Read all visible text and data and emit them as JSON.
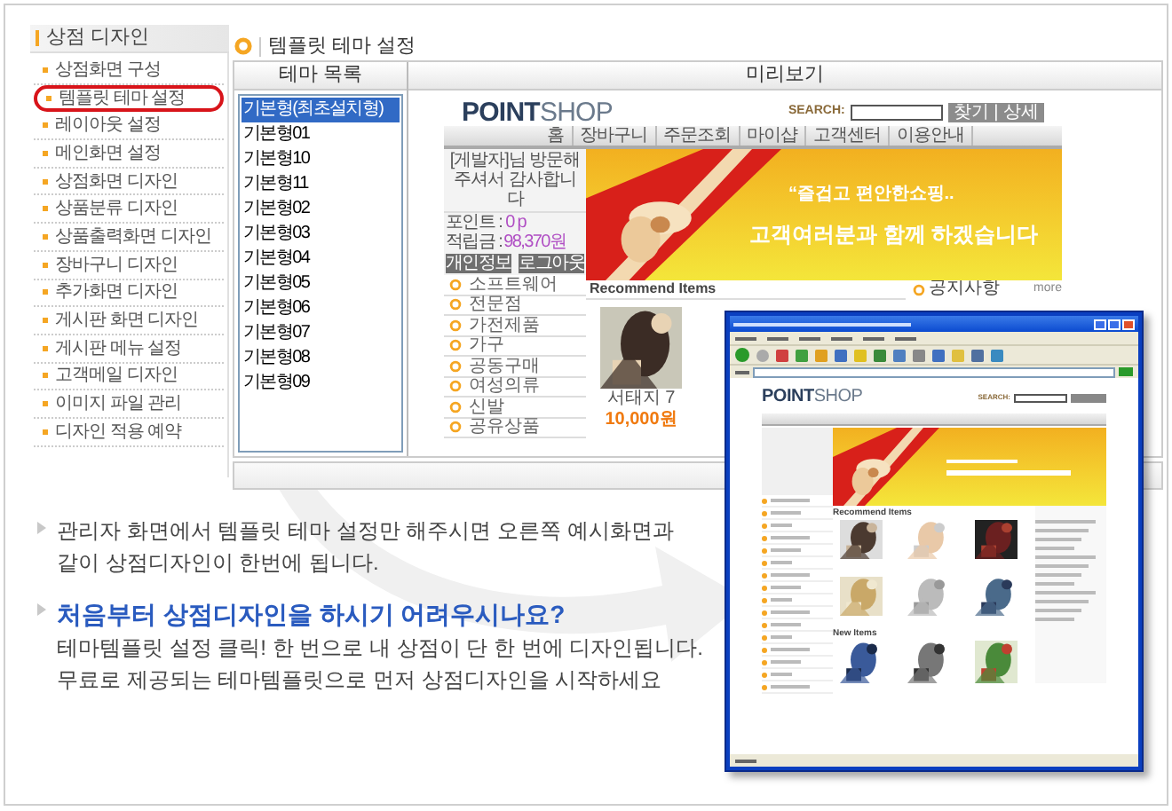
{
  "sidebar": {
    "title": "상점 디자인",
    "items": [
      {
        "label": "상점화면 구성",
        "selected": false
      },
      {
        "label": "템플릿 테마 설정",
        "selected": true
      },
      {
        "label": "레이아웃 설정",
        "selected": false
      },
      {
        "label": "메인화면 설정",
        "selected": false
      },
      {
        "label": "상점화면 디자인",
        "selected": false
      },
      {
        "label": "상품분류 디자인",
        "selected": false
      },
      {
        "label": "상품출력화면 디자인",
        "selected": false
      },
      {
        "label": "장바구니 디자인",
        "selected": false
      },
      {
        "label": "추가화면 디자인",
        "selected": false
      },
      {
        "label": "게시판 화면 디자인",
        "selected": false
      },
      {
        "label": "게시판 메뉴 설정",
        "selected": false
      },
      {
        "label": "고객메일 디자인",
        "selected": false
      },
      {
        "label": "이미지 파일 관리",
        "selected": false
      },
      {
        "label": "디자인 적용 예약",
        "selected": false
      }
    ]
  },
  "page_title": "템플릿 테마 설정",
  "theme_list": {
    "header": "테마 목록",
    "items": [
      {
        "label": "기본형(최초설치형)",
        "selected": true
      },
      {
        "label": "기본형01",
        "selected": false
      },
      {
        "label": "기본형10",
        "selected": false
      },
      {
        "label": "기본형11",
        "selected": false
      },
      {
        "label": "기본형02",
        "selected": false
      },
      {
        "label": "기본형03",
        "selected": false
      },
      {
        "label": "기본형04",
        "selected": false
      },
      {
        "label": "기본형05",
        "selected": false
      },
      {
        "label": "기본형06",
        "selected": false
      },
      {
        "label": "기본형07",
        "selected": false
      },
      {
        "label": "기본형08",
        "selected": false
      },
      {
        "label": "기본형09",
        "selected": false
      }
    ]
  },
  "preview": {
    "header": "미리보기",
    "logo": {
      "part_1": "POINT",
      "part_2": "SHOP"
    },
    "search_label": "SEARCH:",
    "search_button": "찾기 | 상세",
    "nav": [
      "홈",
      "장바구니",
      "주문조회",
      "마이샵",
      "고객센터",
      "이용안내"
    ],
    "greeting": "[게발자]님 방문해주셔서 감사합니다",
    "points_label": "포인트 :",
    "points_value": "0 p",
    "savings_label": "적립금 :",
    "savings_value": "98,370원",
    "buttons": [
      "개인정보",
      "로그아웃"
    ],
    "categories": [
      "소프트웨어",
      "전문점",
      "가전제품",
      "가구",
      "공동구매",
      "여성의류",
      "신발",
      "공유상품"
    ],
    "banner": {
      "line_1": "“즐겁고 편안한쇼핑..",
      "line_2": "고객여러분과 함께 하겠습니다"
    },
    "recommend_title": "Recommend Items",
    "products": [
      {
        "name": "서태지 7",
        "price": "10,000원"
      }
    ],
    "notice_title": "공지사항",
    "notice_more": "more"
  },
  "popup": {
    "logo": {
      "part_1": "POINT",
      "part_2": "SHOP"
    },
    "search_label": "SEARCH:",
    "recommend_title": "Recommend Items",
    "new_title": "New Items"
  },
  "notes": [
    {
      "kind": "plain",
      "text": "관리자 화면에서 템플릿 테마 설정만 해주시면 오른쪽 예시화면과 같이 상점디자인이 한번에 됩니다."
    },
    {
      "kind": "headed",
      "heading": "처음부터 상점디자인을 하시기 어려우시나요?",
      "lines": [
        "테마템플릿 설정 클릭! 한 번으로 내 상점이 단 한 번에 디자인됩니다.",
        "무료로 제공되는 테마템플릿으로 먼저 상점디자인을 시작하세요"
      ]
    }
  ]
}
